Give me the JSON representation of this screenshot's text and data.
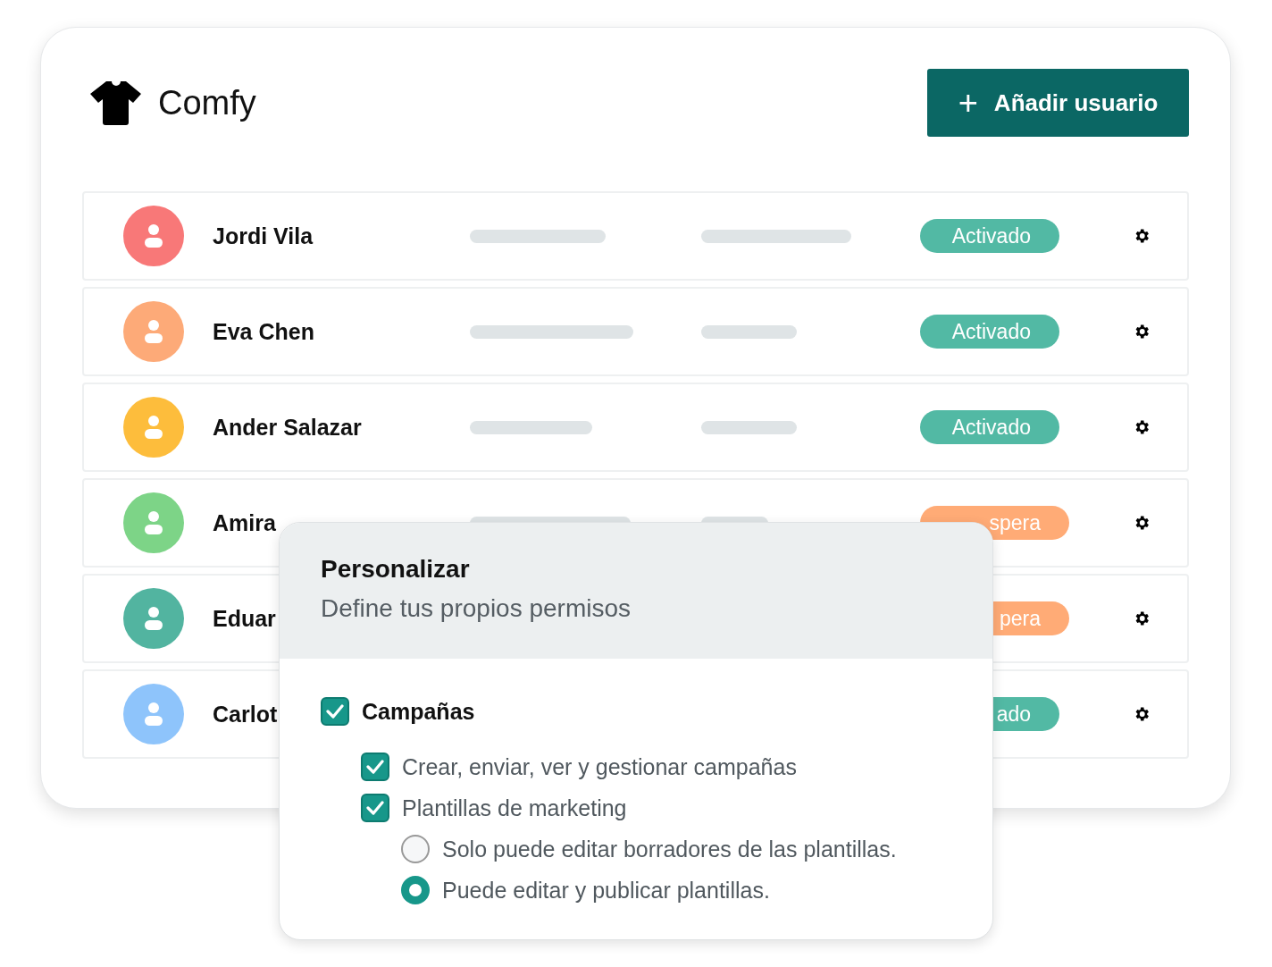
{
  "brand": {
    "name": "Comfy"
  },
  "add_button": {
    "icon": "+",
    "label": "Añadir usuario"
  },
  "users": [
    {
      "name": "Jordi Vila",
      "avatar": {
        "color": "#f87878"
      },
      "placeholder_bars": true,
      "status": {
        "text": "Activado",
        "color": "#52b9a4"
      }
    },
    {
      "name": "Eva Chen",
      "avatar": {
        "color": "#fdaa78"
      },
      "placeholder_bars": true,
      "status": {
        "text": "Activado",
        "color": "#52b9a4"
      }
    },
    {
      "name": "Ander Salazar",
      "avatar": {
        "color": "#fdbd3c"
      },
      "placeholder_bars": true,
      "status": {
        "text": "Activado",
        "color": "#52b9a4"
      }
    },
    {
      "name": "Amira",
      "avatar": {
        "color": "#7dd487"
      },
      "placeholder_bars": true,
      "status": {
        "text": "spera",
        "color": "#ffab76"
      }
    },
    {
      "name": "Eduar",
      "avatar": {
        "color": "#52b4a0"
      },
      "placeholder_bars": false,
      "status": {
        "text": "pera",
        "color": "#ffab76"
      }
    },
    {
      "name": "Carlot",
      "avatar": {
        "color": "#8ec4fb"
      },
      "placeholder_bars": false,
      "status": {
        "text": "ado",
        "color": "#52b9a4"
      }
    }
  ],
  "permissions_popup": {
    "title": "Personalizar",
    "subtitle": "Define tus propios permisos",
    "options": [
      {
        "kind": "checkbox",
        "label": "Campañas",
        "checked": true,
        "children": [
          {
            "kind": "checkbox",
            "label": "Crear, enviar, ver y gestionar campañas",
            "checked": true
          },
          {
            "kind": "checkbox",
            "label": "Plantillas de marketing",
            "checked": true,
            "children": [
              {
                "kind": "radio",
                "label": "Solo puede editar borradores de las plantillas.",
                "selected": false
              },
              {
                "kind": "radio",
                "label": "Puede editar y publicar plantillas.",
                "selected": true
              }
            ]
          }
        ]
      }
    ]
  }
}
